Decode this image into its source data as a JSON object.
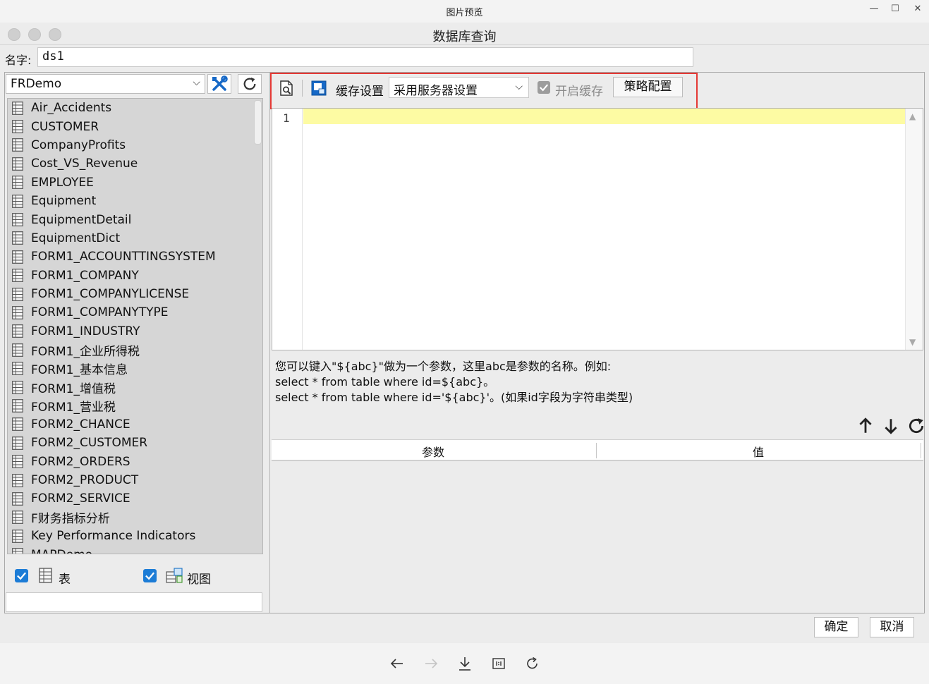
{
  "preview": {
    "title": "图片预览",
    "minimize": "—",
    "maximize": "☐",
    "close": "✕"
  },
  "dialog": {
    "title": "数据库查询",
    "name_label": "名字:",
    "name_value": "ds1"
  },
  "datasource": {
    "selected": "FRDemo"
  },
  "tables": [
    "Air_Accidents",
    "CUSTOMER",
    "CompanyProfits",
    "Cost_VS_Revenue",
    "EMPLOYEE",
    "Equipment",
    "EquipmentDetail",
    "EquipmentDict",
    "FORM1_ACCOUNTTINGSYSTEM",
    "FORM1_COMPANY",
    "FORM1_COMPANYLICENSE",
    "FORM1_COMPANYTYPE",
    "FORM1_INDUSTRY",
    "FORM1_企业所得税",
    "FORM1_基本信息",
    "FORM1_增值税",
    "FORM1_营业税",
    "FORM2_CHANCE",
    "FORM2_CUSTOMER",
    "FORM2_ORDERS",
    "FORM2_PRODUCT",
    "FORM2_SERVICE",
    "F财务指标分析",
    "Key Performance Indicators",
    "MAPDemo"
  ],
  "filters": {
    "table_label": "表",
    "view_label": "视图"
  },
  "toolbar": {
    "cache_label": "缓存设置",
    "cache_mode": "采用服务器设置",
    "enable_cache_label": "开启缓存",
    "strategy_button": "策略配置"
  },
  "editor": {
    "line_number": "1"
  },
  "hint": {
    "text": "您可以键入\"${abc}\"做为一个参数，这里abc是参数的名称。例如:\nselect * from table where id=${abc}。\nselect * from table where id='${abc}'。(如果id字段为字符串类型)"
  },
  "params": {
    "col_param": "参数",
    "col_value": "值"
  },
  "buttons": {
    "ok": "确定",
    "cancel": "取消"
  },
  "colors": {
    "highlight_box": "#e53935",
    "checkbox_blue": "#1c7cd6",
    "editor_line": "#fdfba3"
  }
}
